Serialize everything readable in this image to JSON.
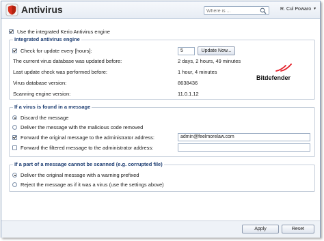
{
  "header": {
    "title": "Antivirus",
    "search_placeholder": "Where is ...",
    "user": "R. Cul Powaro"
  },
  "main": {
    "use_integrated_label": "Use the integrated Kerio Antivirus engine",
    "engine_section": {
      "legend": "Integrated antivirus engine",
      "check_update_label": "Check for update every [hours]:",
      "check_update_value": "5",
      "update_now_button": "Update Now...",
      "rows": [
        {
          "label": "The current virus database was updated before:",
          "value": "2 days, 2 hours, 49 minutes"
        },
        {
          "label": "Last update check was performed before:",
          "value": "1 hour, 4 minutes"
        },
        {
          "label": "Virus database version:",
          "value": "8638436"
        },
        {
          "label": "Scanning engine version:",
          "value": "11.0.1.12"
        }
      ],
      "brand": "Bitdefender"
    },
    "virus_found_section": {
      "legend": "If a virus is found in a message",
      "discard_label": "Discard the message",
      "deliver_label": "Deliver the message with the malicious code removed",
      "forward_original_label": "Forward the original message to the administrator address:",
      "forward_original_value": "admin@feelmorelaw.com",
      "forward_filtered_label": "Forward the filtered message to the administrator address:",
      "forward_filtered_value": ""
    },
    "cannot_scan_section": {
      "legend": "If a part of a message cannot be scanned (e.g. corrupted file)",
      "deliver_warning_label": "Deliver the original message with a warning prefixed",
      "reject_label": "Reject the message as if it was a virus (use the settings above)"
    }
  },
  "footer": {
    "apply_button": "Apply",
    "reset_button": "Reset"
  },
  "colors": {
    "legend": "#1f3f73",
    "brand_red": "#e4212b",
    "shield_red": "#d8301f"
  }
}
